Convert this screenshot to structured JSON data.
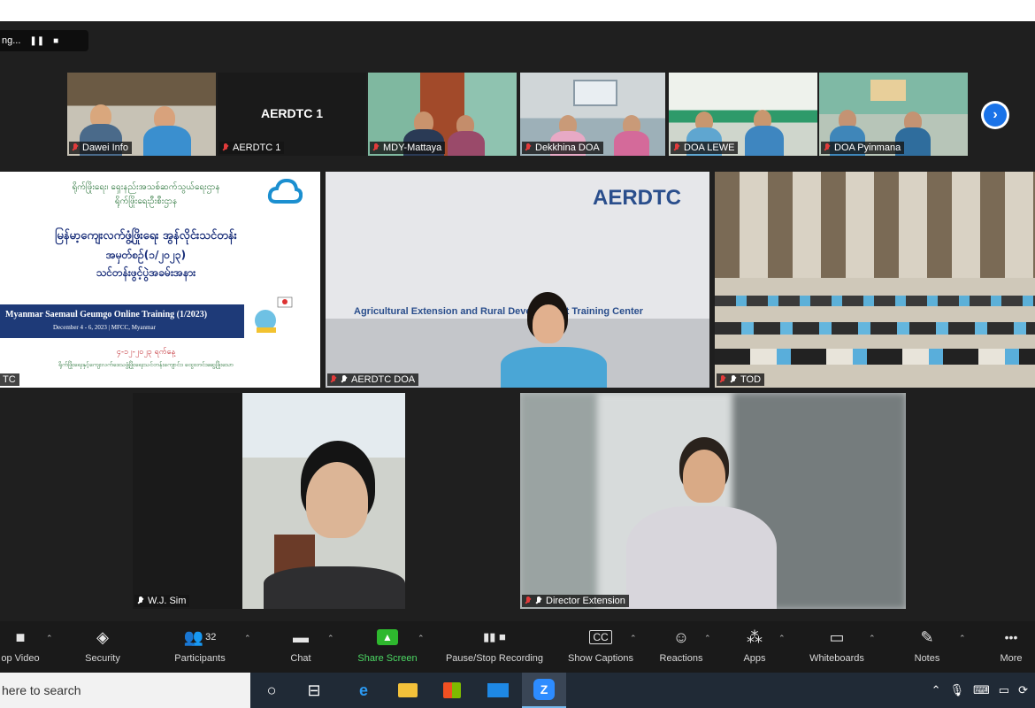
{
  "recording": {
    "label": "ng...",
    "pause_icon": "pause-icon",
    "stop_icon": "stop-icon"
  },
  "thumbnails": [
    {
      "name": "Dawei Info"
    },
    {
      "name": "AERDTC 1",
      "display_name": "AERDTC 1"
    },
    {
      "name": "MDY-Mattaya"
    },
    {
      "name": "Dekkhina DOA"
    },
    {
      "name": "DOA LEWE"
    },
    {
      "name": "DOA Pyinmana"
    }
  ],
  "slide": {
    "line1": "ရိုက်ဖြိုးရေး၊ ရှေးနည်းအသစ်ဆက်သွယ်ရေးဌာန",
    "line2": "ရိုက်ဖြိုးရေးဦးစီးဌာန",
    "line3": "မြန်မာ့ကျေးလက်ဖွံ့ဖြိုးရေး အွန်လိုင်းသင်တန်း",
    "line4": "အမှတ်စဉ်(၁/၂၀၂၃)",
    "line5": "သင်တန်းဖွင့်ပွဲအခမ်းအနား",
    "banner_title": "Myanmar Saemaul Geumgo Online Training (1/2023)",
    "banner_sub": "December 4 - 6, 2023 | MFCC, Myanmar",
    "date": "၄-၁၂-၂၀၂၃ ရက်နေ့",
    "footer": "ရိုက်ဖြိုးရေးနှင့်ကျေးလက်ဒေသဖွံ့ဖြိုးရေးသင်တန်းကျောင်း၊ ထွေးတင်းဆွေ့ဖြိုးသော",
    "tag": "TC"
  },
  "aerdtc_tile": {
    "logo_text": "AERDTC",
    "banner": "Agricultural Extension and Rural Development Training Center",
    "tag": "AERDTC DOA"
  },
  "hall_tile": {
    "tag": "TOD"
  },
  "speakers": [
    {
      "tag": "W.J. Sim"
    },
    {
      "tag": "Director Extension"
    }
  ],
  "toolbar": {
    "items": [
      {
        "label": "op Video",
        "icon": "video-camera-icon",
        "glyph": "■"
      },
      {
        "label": "Security",
        "icon": "shield-icon",
        "glyph": "◈"
      },
      {
        "label": "Participants",
        "icon": "participants-icon",
        "glyph": "👥",
        "count": "32"
      },
      {
        "label": "Chat",
        "icon": "chat-icon",
        "glyph": "▬"
      },
      {
        "label": "Share Screen",
        "icon": "share-screen-icon",
        "glyph": "▲"
      },
      {
        "label": "Pause/Stop Recording",
        "icon": "pause-stop-icon",
        "glyph": "▮▮ ■"
      },
      {
        "label": "Show Captions",
        "icon": "captions-icon",
        "glyph": "CC"
      },
      {
        "label": "Reactions",
        "icon": "reactions-icon",
        "glyph": "☺"
      },
      {
        "label": "Apps",
        "icon": "apps-icon",
        "glyph": "⁂"
      },
      {
        "label": "Whiteboards",
        "icon": "whiteboard-icon",
        "glyph": "▭"
      },
      {
        "label": "Notes",
        "icon": "notes-icon",
        "glyph": "✎"
      },
      {
        "label": "More",
        "icon": "more-icon",
        "glyph": "•••"
      }
    ]
  },
  "taskbar": {
    "search_placeholder": "here to search",
    "icons": [
      "cortana-icon",
      "task-view-icon",
      "edge-icon",
      "file-explorer-icon",
      "store-icon",
      "mail-icon",
      "zoom-icon"
    ],
    "tray": [
      "chevron-up-icon",
      "microphone-icon",
      "keyboard-icon",
      "network-icon",
      "sync-icon"
    ]
  },
  "colors": {
    "accent_green": "#2eb82e",
    "accent_blue": "#1a73e8",
    "mute_red": "#e23b3b"
  }
}
